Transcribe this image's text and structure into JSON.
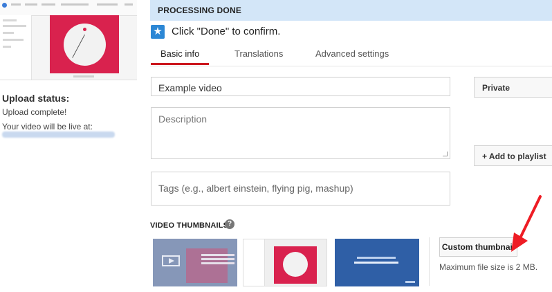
{
  "processing_banner": "PROCESSING DONE",
  "confirm": {
    "icon": "star-icon",
    "text": "Click \"Done\" to confirm."
  },
  "tabs": [
    {
      "label": "Basic info",
      "active": true
    },
    {
      "label": "Translations",
      "active": false
    },
    {
      "label": "Advanced settings",
      "active": false
    }
  ],
  "fields": {
    "title_value": "Example video",
    "description_placeholder": "Description",
    "tags_placeholder": "Tags (e.g., albert einstein, flying pig, mashup)"
  },
  "privacy_label": "Private",
  "add_to_playlist_label": "+ Add to playlist",
  "thumbnails": {
    "section_label": "VIDEO THUMBNAILS",
    "help_icon": "?",
    "custom_button": "Custom thumbnail",
    "max_size_note": "Maximum file size is 2 MB."
  },
  "upload": {
    "title": "Upload status:",
    "status": "Upload complete!",
    "live_text": "Your video will be live at:"
  },
  "colors": {
    "banner_bg": "#d3e6f8",
    "accent_red": "#cc181e",
    "arrow_red": "#ee1c24",
    "star_blue": "#2c87d5"
  }
}
